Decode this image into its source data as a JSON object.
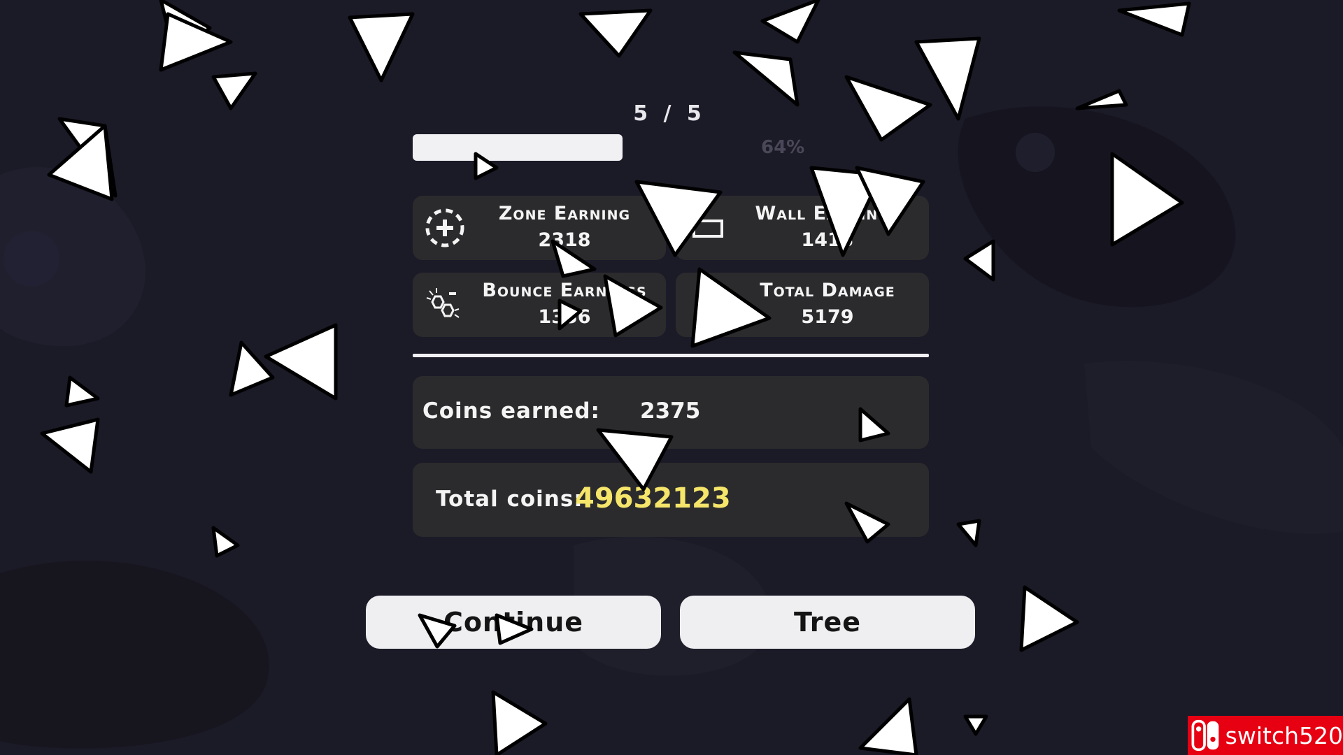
{
  "wave": {
    "label": "5 / 5"
  },
  "progress": {
    "fraction": 0.64,
    "label": "64%"
  },
  "stats": [
    {
      "title": "Zone Earning",
      "value": "2318",
      "icon": "dashed-circle-plus-icon"
    },
    {
      "title": "Wall Earnings",
      "value": "1413",
      "icon": "wall-icon"
    },
    {
      "title": "Bounce Earnings",
      "value": "1336",
      "icon": "molecule-icon"
    },
    {
      "title": "Total Damage",
      "value": "5179",
      "icon": "damage-icon"
    }
  ],
  "coins": {
    "label": "Coins earned:",
    "value": "2375"
  },
  "total": {
    "label": "Total coins:",
    "value": "49632123",
    "color": "#f5e56a"
  },
  "buttons": {
    "continue": "Continue",
    "tree": "Tree"
  },
  "watermark": {
    "text": "switch520",
    "color": "#e60012"
  }
}
